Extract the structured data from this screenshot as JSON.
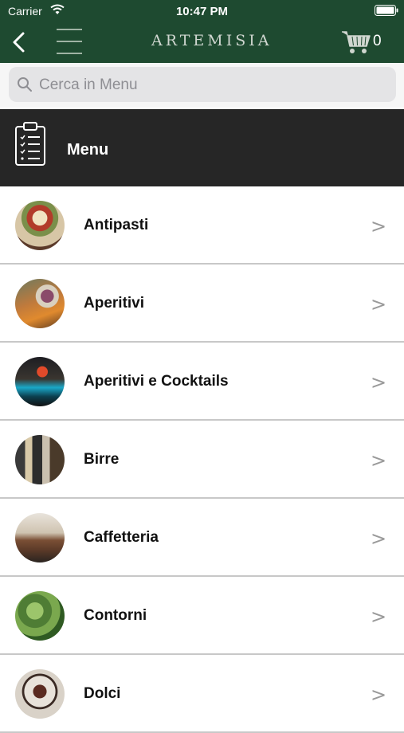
{
  "status_bar": {
    "carrier": "Carrier",
    "time": "10:47 PM"
  },
  "nav": {
    "logo_text": "ARTEMISIA",
    "cart_count": "0",
    "brand_color": "#1e4a30"
  },
  "search": {
    "placeholder": "Cerca in Menu",
    "value": ""
  },
  "header": {
    "title": "Menu",
    "icon": "clipboard-list-icon"
  },
  "categories": [
    {
      "label": "Antipasti",
      "chevron": ">"
    },
    {
      "label": "Aperitivi",
      "chevron": ">"
    },
    {
      "label": "Aperitivi e Cocktails",
      "chevron": ">"
    },
    {
      "label": "Birre",
      "chevron": ">"
    },
    {
      "label": "Caffetteria",
      "chevron": ">"
    },
    {
      "label": "Contorni",
      "chevron": ">"
    },
    {
      "label": "Dolci",
      "chevron": ">"
    }
  ]
}
